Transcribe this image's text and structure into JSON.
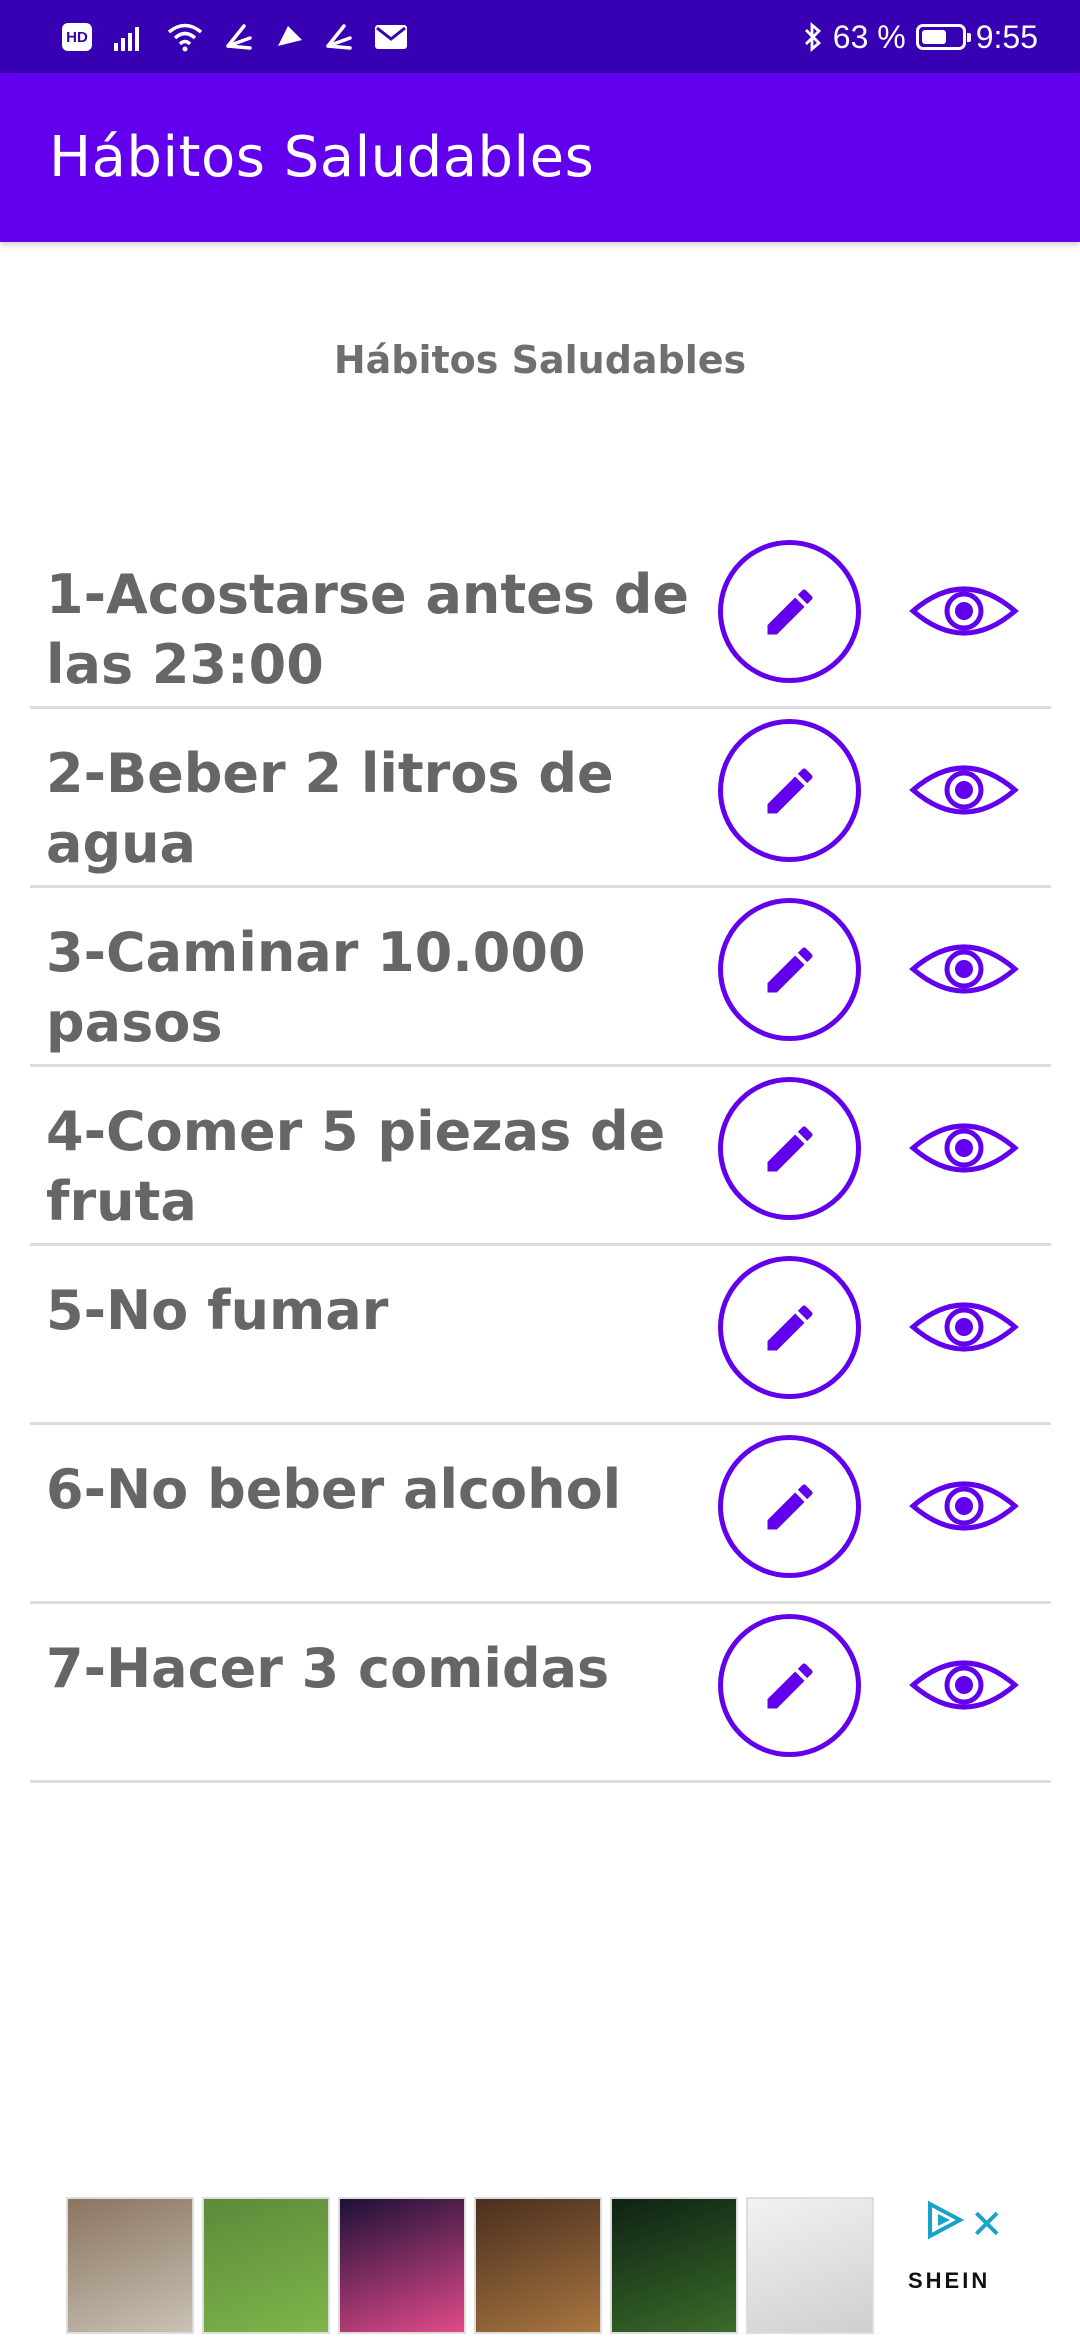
{
  "status_bar": {
    "hd_badge": "HD",
    "battery_text": "63 %",
    "battery_level": 0.63,
    "time": "9:55"
  },
  "app_bar": {
    "title": "Hábitos Saludables"
  },
  "main": {
    "heading": "Hábitos Saludables",
    "habits": [
      {
        "label": "1-Acostarse antes de las 23:00"
      },
      {
        "label": "2-Beber 2 litros de agua"
      },
      {
        "label": "3-Caminar 10.000 pasos"
      },
      {
        "label": "4-Comer 5 piezas de fruta"
      },
      {
        "label": "5-No fumar"
      },
      {
        "label": "6-No beber alcohol"
      },
      {
        "label": "7-Hacer 3 comidas"
      }
    ]
  },
  "ad": {
    "brand": "SHEIN",
    "thumb_count": 6
  },
  "colors": {
    "status_bar": "#3700b3",
    "app_bar": "#6200ee",
    "accent": "#6200ee",
    "habit_text": "#666666",
    "ad_icon": "#17a2c8"
  },
  "icons": {
    "edit": "pencil-icon",
    "view": "eye-icon",
    "ad_close": "close-icon",
    "ad_choices": "ad-choices-icon"
  }
}
